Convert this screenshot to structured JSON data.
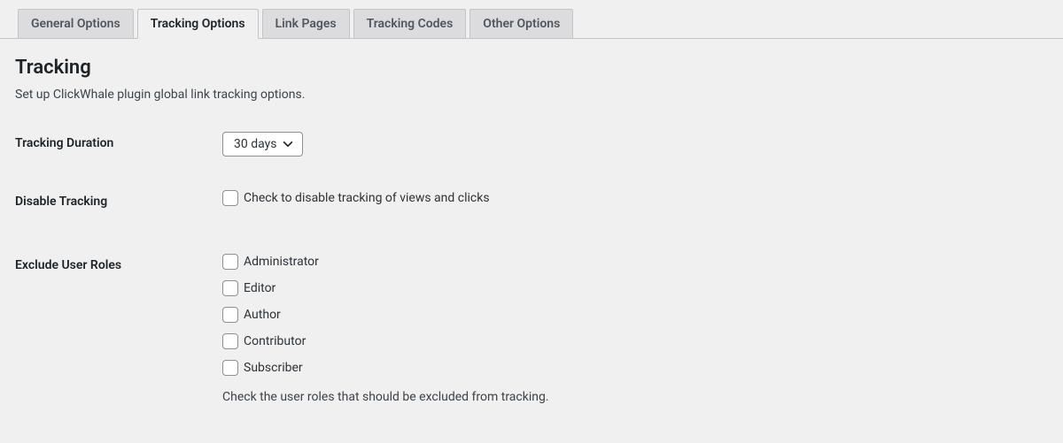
{
  "tabs": [
    {
      "label": "General Options",
      "active": false
    },
    {
      "label": "Tracking Options",
      "active": true
    },
    {
      "label": "Link Pages",
      "active": false
    },
    {
      "label": "Tracking Codes",
      "active": false
    },
    {
      "label": "Other Options",
      "active": false
    }
  ],
  "section": {
    "title": "Tracking",
    "description": "Set up ClickWhale plugin global link tracking options."
  },
  "tracking_duration": {
    "label": "Tracking Duration",
    "value": "30 days"
  },
  "disable_tracking": {
    "label": "Disable Tracking",
    "checkbox_label": "Check to disable tracking of views and clicks"
  },
  "exclude_roles": {
    "label": "Exclude User Roles",
    "roles": [
      "Administrator",
      "Editor",
      "Author",
      "Contributor",
      "Subscriber"
    ],
    "help": "Check the user roles that should be excluded from tracking."
  }
}
